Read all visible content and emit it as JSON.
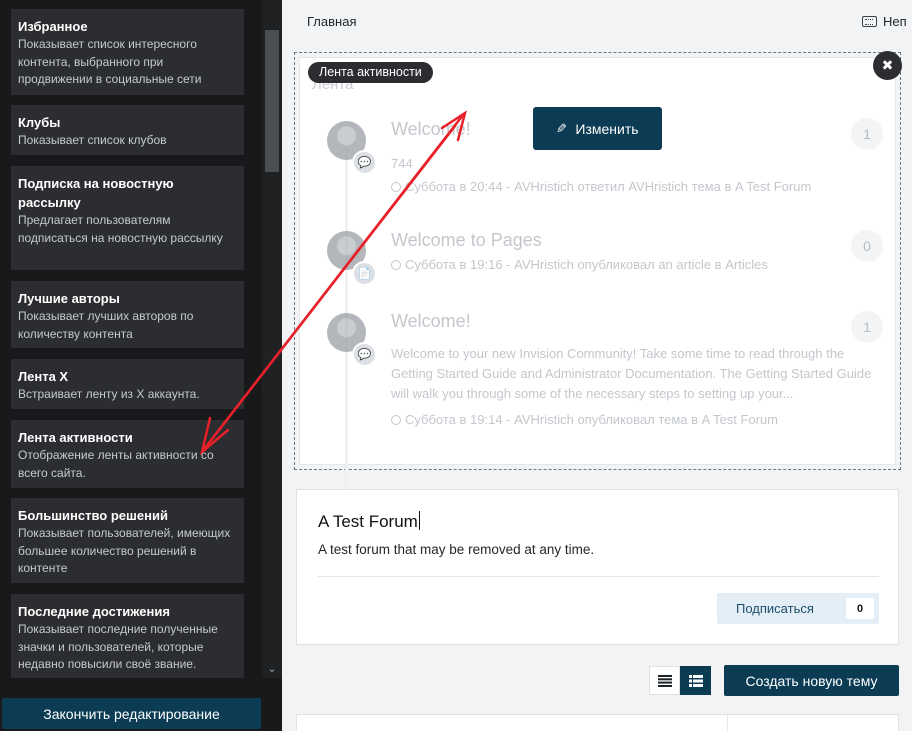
{
  "sidebar": {
    "blocks": [
      {
        "title": "Избранное",
        "desc": "Показывает список интересного контента, выбранного при продвижении в социальные сети"
      },
      {
        "title": "Клубы",
        "desc": "Показывает список клубов"
      },
      {
        "title": "Подписка на новостную рассылку",
        "desc": "Предлагает пользователям подписаться на новостную рассылку"
      },
      {
        "title": "Лучшие авторы",
        "desc": "Показывает лучших авторов по количеству контента"
      },
      {
        "title": "Лента X",
        "desc": "Встраивает ленту из X аккаунта."
      },
      {
        "title": "Лента активности",
        "desc": "Отображение ленты активности со всего сайта."
      },
      {
        "title": "Большинство решений",
        "desc": "Показывает пользователей, имеющих большее количество решений в контенте"
      },
      {
        "title": "Последние достижения",
        "desc": "Показывает последние полученные значки и пользователей, которые недавно повысили своё звание."
      }
    ],
    "finish_label": "Закончить редактирование"
  },
  "header": {
    "breadcrumb": "Главная",
    "right_label": "Неп"
  },
  "feed_widget": {
    "tag": "Лента активности",
    "bg_title": "Лента",
    "edit_label": "Изменить",
    "close_glyph": "✖",
    "items": [
      {
        "title": "Welcome!",
        "body": "744",
        "meta": "Суббота в 20:44 - AVHristich ответил AVHristich тема в A Test Forum",
        "count": "1",
        "icon": "comment-icon"
      },
      {
        "title": "Welcome to Pages",
        "body": "",
        "meta": "Суббота в 19:16 - AVHristich опубликовал an article в Articles",
        "count": "0",
        "icon": "document-icon"
      },
      {
        "title": "Welcome!",
        "body": "Welcome to your new Invision Community! Take some time to read through the Getting Started Guide and Administrator Documentation. The Getting Started Guide will walk you through some of the necessary steps to setting up your...",
        "meta": "Суббота в 19:14 - AVHristich опубликовал тема в A Test Forum",
        "count": "1",
        "icon": "comment-icon"
      }
    ]
  },
  "forum": {
    "title": "A Test Forum",
    "desc": "A test forum that may be removed at any time.",
    "subscribe_label": "Подписаться",
    "subscribe_count": "0"
  },
  "toolbar": {
    "create_label": "Создать новую тему"
  },
  "colors": {
    "accent": "#0b3c53",
    "sidebar_bg": "#17191b",
    "block_bg": "#2b2d30",
    "annotation_arrow": "#e8202a"
  }
}
